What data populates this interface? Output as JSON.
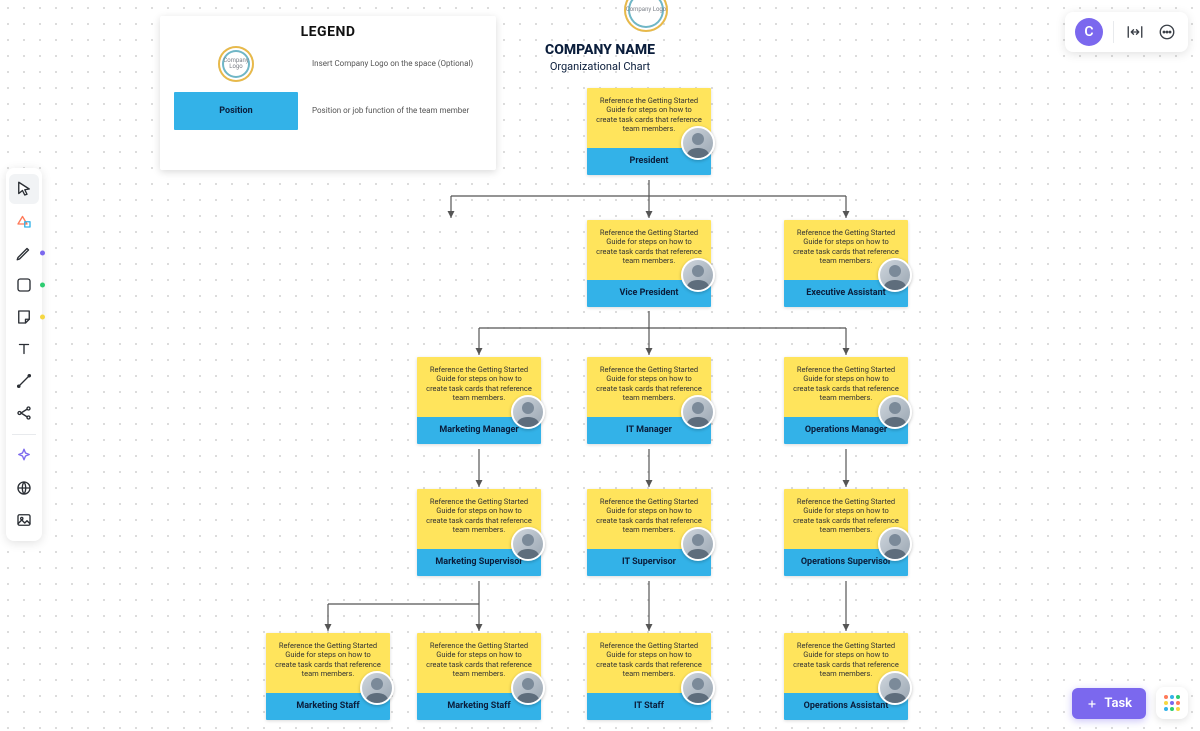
{
  "user": {
    "initial": "C"
  },
  "task_button": {
    "label": "Task"
  },
  "legend": {
    "title": "LEGEND",
    "logo_text": "Company Logo",
    "logo_desc": "Insert Company Logo on the space (Optional)",
    "position_label": "Position",
    "position_desc": "Position or job function of the team member"
  },
  "header": {
    "logo_text": "Company Logo",
    "company_name": "COMPANY NAME",
    "subtitle": "Organizational Chart"
  },
  "card_description": "Reference the Getting Started Guide for steps on how to create task cards that reference team members.",
  "nodes": {
    "president": {
      "role": "President"
    },
    "vice_president": {
      "role": "Vice President"
    },
    "executive_assistant": {
      "role": "Executive Assistant"
    },
    "marketing_manager": {
      "role": "Marketing Manager"
    },
    "it_manager": {
      "role": "IT Manager"
    },
    "operations_manager": {
      "role": "Operations Manager"
    },
    "marketing_supervisor": {
      "role": "Marketing Supervisor"
    },
    "it_supervisor": {
      "role": "IT Supervisor"
    },
    "operations_supervisor": {
      "role": "Operations Supervisor"
    },
    "marketing_staff_1": {
      "role": "Marketing Staff"
    },
    "marketing_staff_2": {
      "role": "Marketing Staff"
    },
    "it_staff": {
      "role": "IT Staff"
    },
    "operations_assistant": {
      "role": "Operations Assistant"
    }
  },
  "toolbar": {
    "items": [
      {
        "name": "select",
        "dot": null
      },
      {
        "name": "shapes",
        "dot": null
      },
      {
        "name": "pen",
        "dot": "#7b68ee"
      },
      {
        "name": "rectangle",
        "dot": "#2ecc71"
      },
      {
        "name": "sticky",
        "dot": "#f5d742"
      },
      {
        "name": "text",
        "dot": null
      },
      {
        "name": "connector",
        "dot": null
      },
      {
        "name": "mindmap",
        "dot": null
      },
      {
        "name": "ai",
        "dot": null
      },
      {
        "name": "web",
        "dot": null
      },
      {
        "name": "image",
        "dot": null
      }
    ]
  }
}
